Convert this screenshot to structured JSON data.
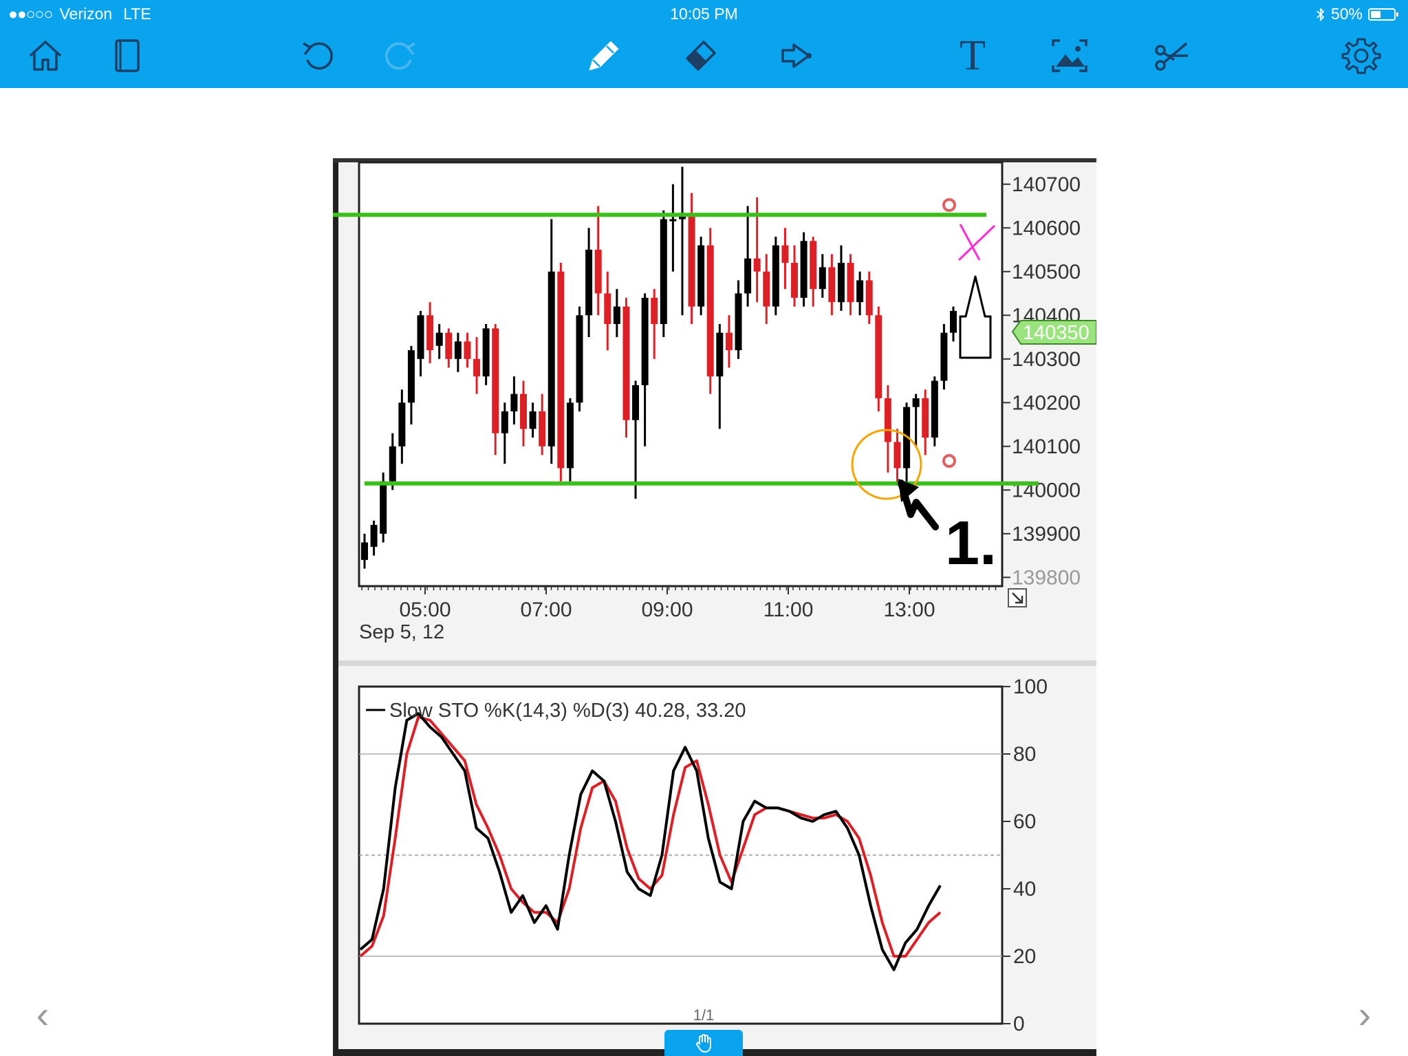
{
  "status_bar": {
    "signal": "●●○○○",
    "carrier": "Verizon",
    "network": "LTE",
    "time": "10:05 PM",
    "battery": "50%"
  },
  "toolbar": {
    "tools": [
      "home-icon",
      "book-icon",
      "undo-icon",
      "redo-icon",
      "pen-icon",
      "eraser-icon",
      "lasso-icon",
      "text-icon",
      "image-icon",
      "scissors-icon",
      "settings-icon"
    ],
    "text_tool_glyph": "T"
  },
  "colors": {
    "toolbar": "#0aa3ee",
    "bullish": "#000000",
    "bearish": "#dd1f26",
    "green_line": "#3bbf1a",
    "orange_circle": "#f4a300",
    "magenta": "#ff2bd6",
    "price_tag": "#9be37f"
  },
  "navigation": {
    "page_indicator": "1/1",
    "prev": "‹",
    "next": "›"
  },
  "chart_data": [
    {
      "type": "candlestick",
      "y_ticks": [
        "140700",
        "140600",
        "140500",
        "140400",
        "140300",
        "140200",
        "140100",
        "140000",
        "139900",
        "139800"
      ],
      "ylim": [
        139780,
        140750
      ],
      "x_ticks": [
        "05:00",
        "07:00",
        "09:00",
        "11:00",
        "13:00"
      ],
      "date_label": "Sep 5, 12",
      "price_tag": "140350",
      "horizontal_lines": [
        140630,
        140015
      ],
      "annotation_label": "1.",
      "candles": [
        [
          139840,
          139880,
          139820,
          139900
        ],
        [
          139870,
          139920,
          139850,
          139930
        ],
        [
          139900,
          140020,
          139880,
          140040
        ],
        [
          140020,
          140100,
          140000,
          140130
        ],
        [
          140100,
          140200,
          140060,
          140230
        ],
        [
          140200,
          140320,
          140150,
          140330
        ],
        [
          140300,
          140400,
          140260,
          140410
        ],
        [
          140400,
          140320,
          140290,
          140430
        ],
        [
          140330,
          140360,
          140300,
          140380
        ],
        [
          140360,
          140300,
          140280,
          140370
        ],
        [
          140300,
          140340,
          140270,
          140360
        ],
        [
          140340,
          140300,
          140280,
          140360
        ],
        [
          140300,
          140260,
          140220,
          140350
        ],
        [
          140260,
          140370,
          140240,
          140380
        ],
        [
          140370,
          140130,
          140080,
          140380
        ],
        [
          140130,
          140180,
          140060,
          140200
        ],
        [
          140180,
          140220,
          140150,
          140260
        ],
        [
          140220,
          140140,
          140100,
          140250
        ],
        [
          140140,
          140180,
          140120,
          140200
        ],
        [
          140180,
          140100,
          140080,
          140220
        ],
        [
          140100,
          140500,
          140060,
          140620
        ],
        [
          140500,
          140050,
          140020,
          140520
        ],
        [
          140050,
          140200,
          140020,
          140210
        ],
        [
          140200,
          140400,
          140180,
          140420
        ],
        [
          140400,
          140550,
          140350,
          140600
        ],
        [
          140550,
          140450,
          140400,
          140650
        ],
        [
          140450,
          140380,
          140320,
          140500
        ],
        [
          140380,
          140420,
          140350,
          140460
        ],
        [
          140420,
          140160,
          140120,
          140440
        ],
        [
          140160,
          140240,
          139980,
          140250
        ],
        [
          140240,
          140440,
          140100,
          140450
        ],
        [
          140440,
          140380,
          140300,
          140460
        ],
        [
          140380,
          140620,
          140350,
          140640
        ],
        [
          140620,
          140620,
          140500,
          140700
        ],
        [
          140620,
          140630,
          140400,
          140740
        ],
        [
          140630,
          140420,
          140380,
          140680
        ],
        [
          140420,
          140560,
          140400,
          140580
        ],
        [
          140560,
          140260,
          140220,
          140600
        ],
        [
          140260,
          140360,
          140140,
          140380
        ],
        [
          140360,
          140320,
          140280,
          140400
        ],
        [
          140320,
          140450,
          140300,
          140480
        ],
        [
          140450,
          140530,
          140420,
          140650
        ],
        [
          140530,
          140500,
          140430,
          140670
        ],
        [
          140500,
          140420,
          140380,
          140540
        ],
        [
          140420,
          140560,
          140400,
          140580
        ],
        [
          140560,
          140520,
          140460,
          140600
        ],
        [
          140520,
          140440,
          140420,
          140560
        ],
        [
          140440,
          140570,
          140420,
          140590
        ],
        [
          140570,
          140460,
          140420,
          140580
        ],
        [
          140460,
          140510,
          140440,
          140540
        ],
        [
          140510,
          140430,
          140400,
          140540
        ],
        [
          140430,
          140520,
          140410,
          140560
        ],
        [
          140520,
          140430,
          140400,
          140540
        ],
        [
          140430,
          140480,
          140400,
          140500
        ],
        [
          140480,
          140400,
          140380,
          140500
        ],
        [
          140400,
          140210,
          140180,
          140420
        ],
        [
          140210,
          140110,
          140040,
          140240
        ],
        [
          140110,
          140050,
          140010,
          140140
        ],
        [
          140050,
          140190,
          140000,
          140200
        ],
        [
          140190,
          140210,
          140100,
          140220
        ],
        [
          140210,
          140120,
          140080,
          140230
        ],
        [
          140120,
          140250,
          140100,
          140260
        ],
        [
          140250,
          140360,
          140230,
          140380
        ],
        [
          140360,
          140410,
          140340,
          140420
        ]
      ]
    },
    {
      "type": "line",
      "title": "Slow STO %K(14,3) %D(3) 40.28, 33.20",
      "y_ticks": [
        "100",
        "80",
        "60",
        "40",
        "20",
        "0"
      ],
      "ylim": [
        0,
        100
      ],
      "series": [
        {
          "name": "%K",
          "color": "#000000",
          "values": [
            22,
            25,
            40,
            70,
            90,
            92,
            88,
            85,
            80,
            75,
            58,
            55,
            45,
            33,
            38,
            30,
            35,
            28,
            50,
            68,
            75,
            72,
            60,
            45,
            40,
            38,
            50,
            75,
            82,
            75,
            55,
            42,
            40,
            60,
            66,
            64,
            64,
            63,
            61,
            60,
            62,
            63,
            58,
            50,
            35,
            22,
            16,
            24,
            28,
            35,
            41
          ]
        },
        {
          "name": "%D",
          "color": "#dd1f26",
          "values": [
            20,
            23,
            32,
            55,
            80,
            91,
            90,
            86,
            82,
            78,
            65,
            58,
            50,
            40,
            36,
            33,
            33,
            30,
            40,
            58,
            70,
            72,
            66,
            52,
            43,
            40,
            44,
            62,
            76,
            78,
            65,
            50,
            42,
            52,
            62,
            64,
            64,
            63,
            62,
            61,
            61,
            62,
            60,
            55,
            44,
            30,
            20,
            20,
            25,
            30,
            33
          ]
        }
      ]
    }
  ]
}
